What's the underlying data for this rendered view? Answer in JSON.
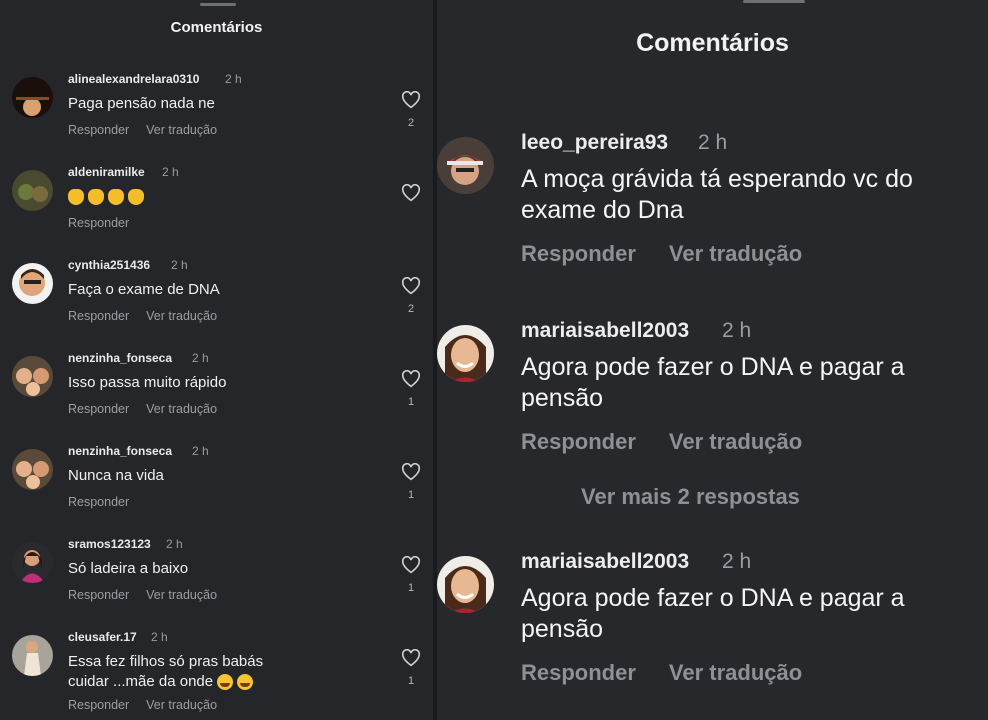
{
  "left": {
    "title": "Comentários",
    "comments": [
      {
        "user": "alinealexandrelara0310",
        "time": "2 h",
        "text": "Paga pensão nada ne",
        "reply": "Responder",
        "translate": "Ver tradução",
        "likes": "2"
      },
      {
        "user": "aldeniramilke",
        "time": "2 h",
        "emojis": [
          "clapping-hands",
          "clapping-hands",
          "clapping-hands",
          "clapping-hands"
        ],
        "reply": "Responder",
        "likes": ""
      },
      {
        "user": "cynthia251436",
        "time": "2 h",
        "text": "Faça o exame de DNA",
        "reply": "Responder",
        "translate": "Ver tradução",
        "likes": "2"
      },
      {
        "user": "nenzinha_fonseca",
        "time": "2 h",
        "text": "Isso passa muito rápido",
        "reply": "Responder",
        "translate": "Ver tradução",
        "likes": "1"
      },
      {
        "user": "nenzinha_fonseca",
        "time": "2 h",
        "text": "Nunca na vida",
        "reply": "Responder",
        "likes": "1"
      },
      {
        "user": "sramos123123",
        "time": "2 h",
        "text": "Só ladeira a baixo",
        "reply": "Responder",
        "translate": "Ver tradução",
        "likes": "1"
      },
      {
        "user": "cleusafer.17",
        "time": "2 h",
        "text": "Essa fez filhos só pras babás cuidar ...mãe da onde",
        "trailing_emojis": [
          "laughing-face",
          "laughing-face"
        ],
        "reply": "Responder",
        "translate": "Ver tradução",
        "likes": "1"
      }
    ]
  },
  "right": {
    "title": "Comentários",
    "comments": [
      {
        "user": "leeo_pereira93",
        "time": "2 h",
        "text": "A moça grávida tá esperando vc do exame do Dna",
        "reply": "Responder",
        "translate": "Ver tradução"
      },
      {
        "user": "mariaisabell2003",
        "time": "2 h",
        "text": "Agora pode fazer o DNA e pagar a pensão",
        "reply": "Responder",
        "translate": "Ver tradução"
      },
      {
        "user": "mariaisabell2003",
        "time": "2 h",
        "text": "Agora pode fazer o DNA e pagar a pensão",
        "reply": "Responder",
        "translate": "Ver tradução"
      }
    ],
    "more_replies": "Ver mais 2 respostas"
  },
  "colors": {
    "background": "#26272b",
    "muted": "#9d9ea3"
  }
}
